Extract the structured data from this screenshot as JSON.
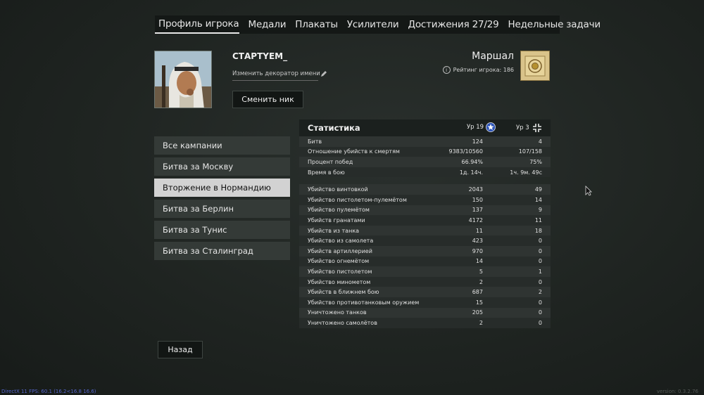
{
  "tabs": [
    {
      "label": "Профиль игрока",
      "active": true
    },
    {
      "label": "Медали",
      "active": false
    },
    {
      "label": "Плакаты",
      "active": false
    },
    {
      "label": "Усилители",
      "active": false
    },
    {
      "label": "Достижения 27/29",
      "active": false
    },
    {
      "label": "Недельные задачи",
      "active": false
    }
  ],
  "profile": {
    "nickname": "СТАРТҮЕМ_",
    "decorator_label": "Изменить декоратор имени",
    "change_nick_label": "Сменить ник",
    "rank_title": "Маршал",
    "rating_label": "Рейтинг игрока: 186"
  },
  "menu": [
    {
      "label": "Все кампании",
      "active": false
    },
    {
      "label": "Битва за Москву",
      "active": false
    },
    {
      "label": "Вторжение в Нормандию",
      "active": true
    },
    {
      "label": "Битва за Берлин",
      "active": false
    },
    {
      "label": "Битва за Тунис",
      "active": false
    },
    {
      "label": "Битва за Сталинград",
      "active": false
    }
  ],
  "stats": {
    "title": "Статистика",
    "level1": "Ур 19",
    "level2": "Ур 3",
    "general": [
      {
        "name": "Битв",
        "v1": "124",
        "v2": "4"
      },
      {
        "name": "Отношение убийств к смертям",
        "v1": "9383/10560",
        "v2": "107/158"
      },
      {
        "name": "Процент побед",
        "v1": "66.94%",
        "v2": "75%"
      },
      {
        "name": "Время в бою",
        "v1": "1д. 14ч.",
        "v2": "1ч. 9м. 49с"
      }
    ],
    "kills": [
      {
        "name": "Убийство винтовкой",
        "v1": "2043",
        "v2": "49"
      },
      {
        "name": "Убийство пистолетом-пулемётом",
        "v1": "150",
        "v2": "14"
      },
      {
        "name": "Убийство пулемётом",
        "v1": "137",
        "v2": "9"
      },
      {
        "name": "Убийств гранатами",
        "v1": "4172",
        "v2": "11"
      },
      {
        "name": "Убийств из танка",
        "v1": "11",
        "v2": "18"
      },
      {
        "name": "Убийство из самолета",
        "v1": "423",
        "v2": "0"
      },
      {
        "name": "Убийств артиллерией",
        "v1": "970",
        "v2": "0"
      },
      {
        "name": "Убийство огнемётом",
        "v1": "14",
        "v2": "0"
      },
      {
        "name": "Убийство пистолетом",
        "v1": "5",
        "v2": "1"
      },
      {
        "name": "Убийство минометом",
        "v1": "2",
        "v2": "0"
      },
      {
        "name": "Убийств в ближнем бою",
        "v1": "687",
        "v2": "2"
      },
      {
        "name": "Убийство противотанковым оружием",
        "v1": "15",
        "v2": "0"
      },
      {
        "name": "Уничтожено танков",
        "v1": "205",
        "v2": "0"
      },
      {
        "name": "Уничтожено самолётов",
        "v1": "2",
        "v2": "0"
      }
    ]
  },
  "back_label": "Назад",
  "fps_text": "DirectX 11 FPS: 60.1 (16.2<16.8 16.6)",
  "version_text": "version: 0.3.2.76"
}
